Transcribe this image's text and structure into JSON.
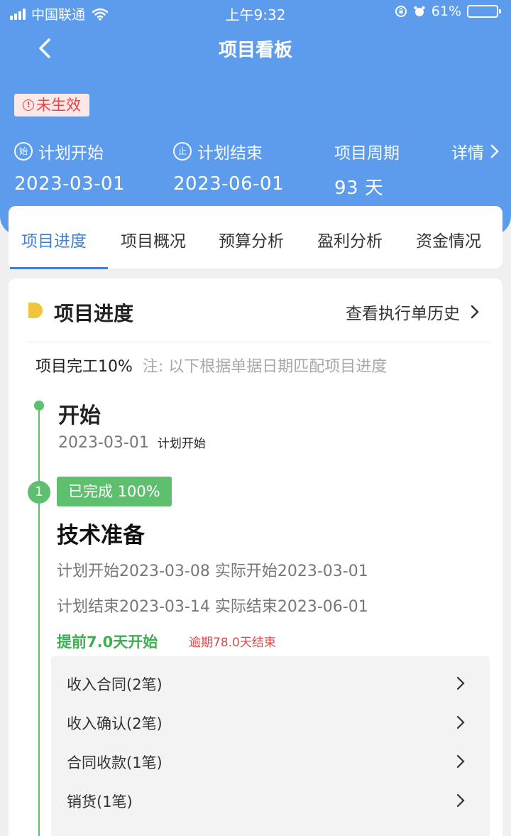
{
  "status_bar": {
    "carrier": "中国联通",
    "time": "上午9:32",
    "battery": "61%",
    "battery_level": 0.61
  },
  "nav": {
    "title": "项目看板"
  },
  "project": {
    "status_badge": "未生效",
    "plan_start_label": "计划开始",
    "plan_start_value": "2023-03-01",
    "plan_end_label": "计划结束",
    "plan_end_value": "2023-06-01",
    "period_label": "项目周期",
    "period_value": "93 天",
    "details_label": "详情",
    "icon_start_char": "始",
    "icon_end_char": "止"
  },
  "tabs": [
    {
      "label": "项目进度",
      "active": true
    },
    {
      "label": "项目概况",
      "active": false
    },
    {
      "label": "预算分析",
      "active": false
    },
    {
      "label": "盈利分析",
      "active": false
    },
    {
      "label": "资金情况",
      "active": false
    }
  ],
  "progress": {
    "section_title": "项目进度",
    "history_link": "查看执行单历史",
    "completion_text": "项目完工10%",
    "note": "注: 以下根据单据日期匹配项目进度",
    "start_title": "开始",
    "start_date": "2023-03-01",
    "start_tag": "计划开始",
    "step1": {
      "number": "1",
      "badge": "已完成 100%",
      "title": "技术准备",
      "plan_start": "计划开始2023-03-08 实际开始2023-03-01",
      "plan_end": "计划结束2023-03-14 实际结束2023-06-01",
      "early": "提前7.0天开始",
      "late": "逾期78.0天结束",
      "docs": [
        "收入合同(2笔)",
        "收入确认(2笔)",
        "合同收款(1笔)",
        "销货(1笔)"
      ]
    }
  },
  "colors": {
    "header_blue": "#5d9cec",
    "tab_active": "#3d82d8",
    "green": "#5ec06e",
    "red": "#e04848",
    "marker_yellow": "#f2c43b"
  }
}
